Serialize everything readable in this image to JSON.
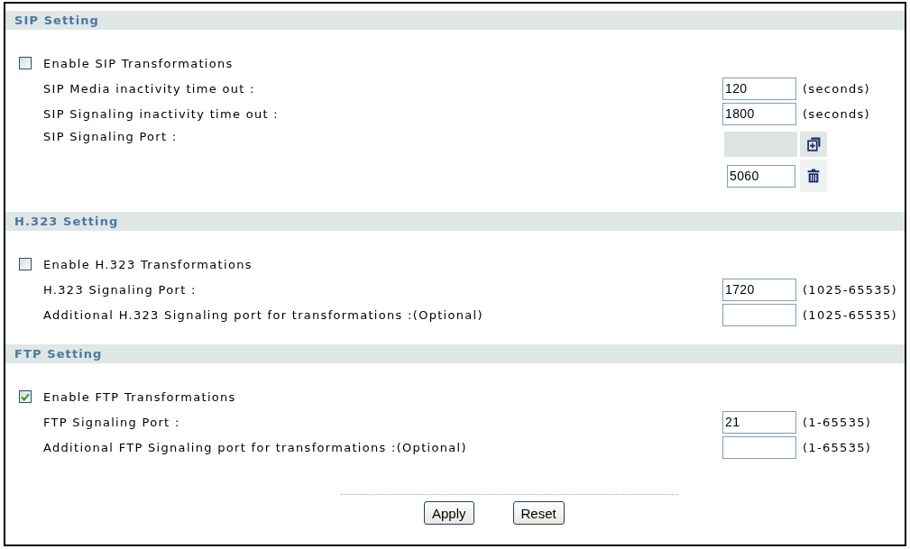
{
  "sections": [
    {
      "title": "SIP Setting",
      "enable": {
        "label": "Enable SIP Transformations",
        "checked": false
      },
      "rows": [
        {
          "kind": "field",
          "label": "SIP Media inactivity time out :",
          "value": "120",
          "unit": "(seconds)"
        },
        {
          "kind": "field",
          "label": "SIP Signaling inactivity time out :",
          "value": "1800",
          "unit": "(seconds)"
        },
        {
          "kind": "port_list",
          "label": "SIP Signaling Port :",
          "entries": [
            {
              "value": "5060"
            }
          ]
        }
      ]
    },
    {
      "title": "H.323 Setting",
      "enable": {
        "label": "Enable H.323 Transformations",
        "checked": false
      },
      "rows": [
        {
          "kind": "field",
          "label": "H.323 Signaling Port :",
          "value": "1720",
          "unit": "(1025-65535)"
        },
        {
          "kind": "field",
          "label": "Additional H.323 Signaling port for transformations :(Optional)",
          "unit": "(1025-65535)"
        }
      ]
    },
    {
      "title": "FTP Setting",
      "enable": {
        "label": "Enable FTP Transformations",
        "checked": true
      },
      "rows": [
        {
          "kind": "field",
          "label": "FTP Signaling Port :",
          "value": "21",
          "unit": "(1-65535)"
        },
        {
          "kind": "field",
          "label": "Additional FTP Signaling port for transformations :(Optional)",
          "unit": "(1-65535)"
        }
      ]
    }
  ],
  "buttons": [
    "Apply",
    "Reset"
  ]
}
